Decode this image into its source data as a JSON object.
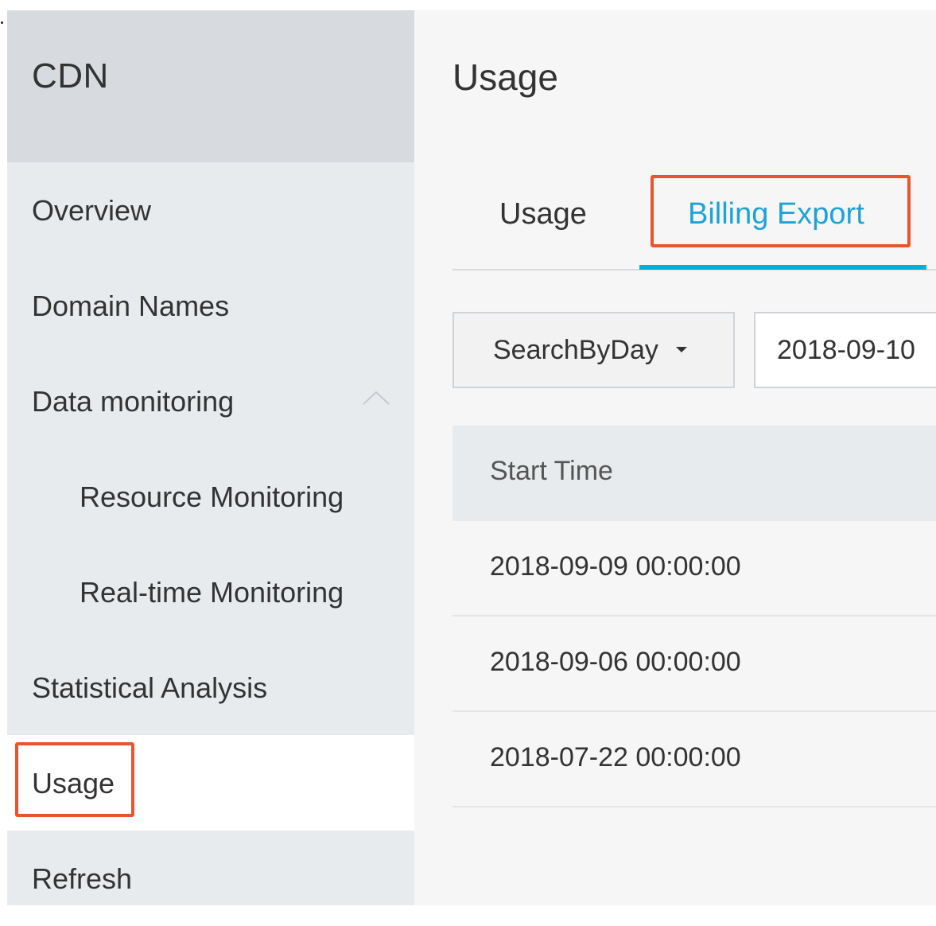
{
  "sidebar": {
    "title": "CDN",
    "items": [
      {
        "label": "Overview"
      },
      {
        "label": "Domain Names"
      },
      {
        "label": "Data monitoring"
      },
      {
        "label": "Resource Monitoring"
      },
      {
        "label": "Real-time Monitoring"
      },
      {
        "label": "Statistical Analysis"
      },
      {
        "label": "Usage"
      },
      {
        "label": "Refresh"
      }
    ],
    "active_item": "Usage"
  },
  "main": {
    "title": "Usage",
    "tabs": [
      {
        "label": "Usage"
      },
      {
        "label": "Billing Export"
      }
    ],
    "active_tab": "Billing Export",
    "filter": {
      "mode_selected": "SearchByDay",
      "date_value": "2018-09-10"
    },
    "table": {
      "columns": [
        "Start Time"
      ],
      "rows": [
        [
          "2018-09-09 00:00:00"
        ],
        [
          "2018-09-06 00:00:00"
        ],
        [
          "2018-07-22 00:00:00"
        ]
      ]
    }
  },
  "colors": {
    "accent": "#00aee0",
    "highlight": "#e8542f",
    "sidebar_bg": "#e8ebee",
    "sidebar_header_bg": "#d7dbdf"
  },
  "icons": {
    "dropdown": "caret-down-icon",
    "collapse": "chevron-up-icon"
  }
}
